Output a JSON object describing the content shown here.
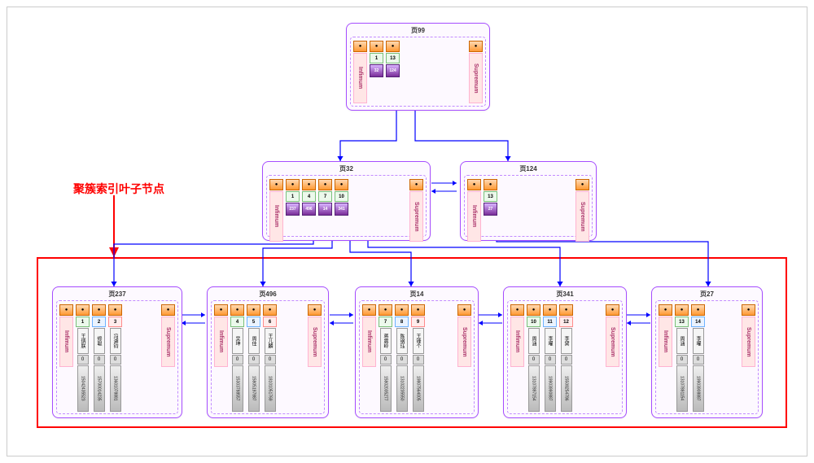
{
  "annotation": "聚簇索引叶子节点",
  "infimum": "Infimum",
  "supremum": "Supremum",
  "dot": "●",
  "tree": {
    "root": {
      "title": "页99",
      "entries": [
        {
          "key": "1",
          "ptr": "32"
        },
        {
          "key": "13",
          "ptr": "124"
        }
      ]
    },
    "mid": [
      {
        "title": "页32",
        "entries": [
          {
            "key": "1",
            "ptr": "237"
          },
          {
            "key": "4",
            "ptr": "496"
          },
          {
            "key": "7",
            "ptr": "14"
          },
          {
            "key": "10",
            "ptr": "341"
          }
        ]
      },
      {
        "title": "页124",
        "entries": [
          {
            "key": "13",
            "ptr": "27"
          }
        ]
      }
    ],
    "leaves": [
      {
        "title": "页237",
        "rows": [
          {
            "key": "1",
            "name": "王炳朕",
            "zero": "0",
            "phone": "15042435523"
          },
          {
            "key": "2",
            "name": "修聪",
            "zero": "0",
            "phone": "15700014235"
          },
          {
            "key": "3",
            "name": "冯湖钧",
            "zero": "0",
            "phone": "13601078881"
          }
        ]
      },
      {
        "title": "页496",
        "rows": [
          {
            "key": "4",
            "name": "吴珅",
            "zero": "0",
            "phone": "15303788557"
          },
          {
            "key": "5",
            "name": "周佳",
            "zero": "0",
            "phone": "15805197887"
          },
          {
            "key": "6",
            "name": "王儿麟",
            "zero": "0",
            "phone": "18101051769"
          }
        ]
      },
      {
        "title": "页14",
        "rows": [
          {
            "key": "7",
            "name": "蒋震岭",
            "zero": "0",
            "phone": "15802035277"
          },
          {
            "key": "8",
            "name": "陈钢珏",
            "zero": "0",
            "phone": "13102235550"
          },
          {
            "key": "9",
            "name": "王锋个",
            "zero": "0",
            "phone": "19807564005"
          }
        ]
      },
      {
        "title": "页341",
        "rows": [
          {
            "key": "10",
            "name": "周涵",
            "zero": "0",
            "phone": "13107897154"
          },
          {
            "key": "11",
            "name": "李曜",
            "zero": "0",
            "phone": "19903990887"
          },
          {
            "key": "12",
            "name": "李黛",
            "zero": "0",
            "phone": "15508254786"
          }
        ]
      },
      {
        "title": "页27",
        "rows": [
          {
            "key": "13",
            "name": "周涵",
            "zero": "0",
            "phone": "13107891154"
          },
          {
            "key": "14",
            "name": "李曜",
            "zero": "0",
            "phone": "19903908887"
          }
        ]
      }
    ]
  },
  "chart_data": {
    "type": "tree",
    "description": "B+Tree clustered index: 3 levels. Root page 99 contains keys [1→page32, 13→page124]. Page 32 → keys [1→237, 4→496, 7→14, 10→341]. Page 124 → key [13→27]. Leaf pages (clustered index leaf nodes, highlighted red box): page 237 rows id 1-3, page 496 rows id 4-6, page 14 rows id 7-9, page 341 rows id 10-12, page 27 rows id 13-14. Leaf pages are doubly linked. Each record stores name + 0 + phone number."
  }
}
